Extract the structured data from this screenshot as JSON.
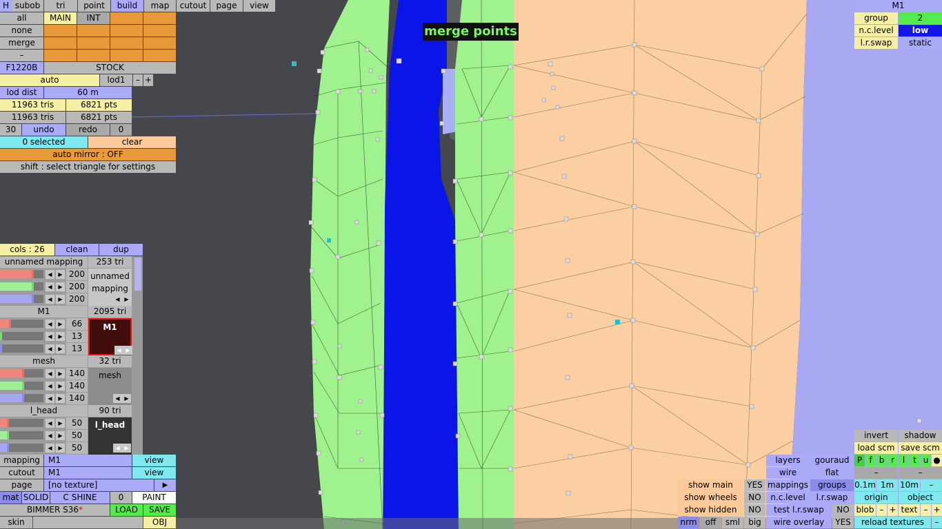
{
  "overlay_title": "merge points",
  "top_tabs": [
    "H",
    "subob",
    "tri",
    "point",
    "build",
    "map",
    "cutout",
    "page",
    "view"
  ],
  "left_panel": {
    "sel_all": "all",
    "sel_none": "none",
    "sel_merge": "merge",
    "sel_minus": "–",
    "main_label": "MAIN",
    "int_label": "INT",
    "code": "F1220B",
    "stock": "STOCK",
    "auto": "auto",
    "lod": "lod1",
    "minus": "–",
    "plus": "+",
    "lod_dist_label": "lod dist",
    "lod_dist_value": "60 m",
    "tris1": "11963 tris",
    "pts1": "6821 pts",
    "tris2": "11963 tris",
    "pts2": "6821 pts",
    "undo_count": "30",
    "undo": "undo",
    "redo": "redo",
    "redo_count": "0",
    "selected": "0 selected",
    "clear": "clear",
    "auto_mirror": "auto mirror : OFF",
    "hint": "shift : select triangle for settings"
  },
  "material_panel": {
    "cols": "cols : 26",
    "clean": "clean",
    "dup": "dup",
    "entries": [
      {
        "name": "unnamed mapping",
        "tri": "253 tri",
        "v1": "200",
        "v2": "200",
        "v3": "200",
        "preview": "unnamed mapping",
        "r": 0.78,
        "g": 0.78,
        "b": 0.78
      },
      {
        "name": "M1",
        "tri": "2095 tri",
        "v1": "66",
        "v2": "13",
        "v3": "13",
        "preview": "M1",
        "r": 0.26,
        "g": 0.05,
        "b": 0.05
      },
      {
        "name": "mesh",
        "tri": "32 tri",
        "v1": "140",
        "v2": "140",
        "v3": "140",
        "preview": "mesh",
        "r": 0.55,
        "g": 0.55,
        "b": 0.55
      },
      {
        "name": "l_head",
        "tri": "90 tri",
        "v1": "50",
        "v2": "50",
        "v3": "50",
        "preview": "l_head",
        "r": 0.2,
        "g": 0.2,
        "b": 0.2
      }
    ]
  },
  "bottom_left": {
    "mapping_label": "mapping",
    "mapping_value": "M1",
    "view1": "view",
    "cutout_label": "cutout",
    "cutout_value": "M1",
    "view2": "view",
    "page_label": "page",
    "page_value": "[no texture]",
    "page_arrow": "▶",
    "mat": "mat",
    "solid": "SOLID",
    "cshine": "C SHINE",
    "zero": "0",
    "paint": "PAINT",
    "car_name": "BIMMER S36",
    "car_mark": "*",
    "load": "LOAD",
    "save": "SAVE",
    "skin": "skin",
    "obj": "OBJ"
  },
  "top_right": {
    "title": "M1",
    "group_label": "group",
    "group_value": "2",
    "nclevel_label": "n.c.level",
    "nclevel_value": "low",
    "lrswap_label": "l.r.swap",
    "lrswap_value": "static"
  },
  "bottom_right": {
    "invert": "invert",
    "shadow": "shadow",
    "load_scm": "load scm",
    "save_scm": "save scm",
    "layers": "layers",
    "gouraud": "gouraud",
    "flags": [
      "P",
      "f",
      "b",
      "r",
      "l",
      "t",
      "u",
      "●"
    ],
    "wire": "wire",
    "flat": "flat",
    "dash1": "–",
    "dash2": "–",
    "mappings": "mappings",
    "groups": "groups",
    "d01": "0.1m",
    "d1": "1m",
    "d10": "10m",
    "dminus": "–",
    "show_main": "show main",
    "yes1": "YES",
    "show_wheels": "show wheels",
    "no1": "NO",
    "show_hidden": "show hidden",
    "no2": "NO",
    "nclevel": "n.c.level",
    "lrswap": "l.r.swap",
    "origin": "origin",
    "object": "object",
    "test_lr": "test l.r.swap",
    "no3": "NO",
    "blob": "blob",
    "bm": "–",
    "bp": "+",
    "text": "text",
    "tm": "–",
    "tp": "+",
    "nrm": "nrm",
    "off": "off",
    "sml": "sml",
    "big": "big",
    "wire_overlay": "wire overlay",
    "yes2": "YES",
    "reload": "reload textures",
    "rminus": "–"
  }
}
